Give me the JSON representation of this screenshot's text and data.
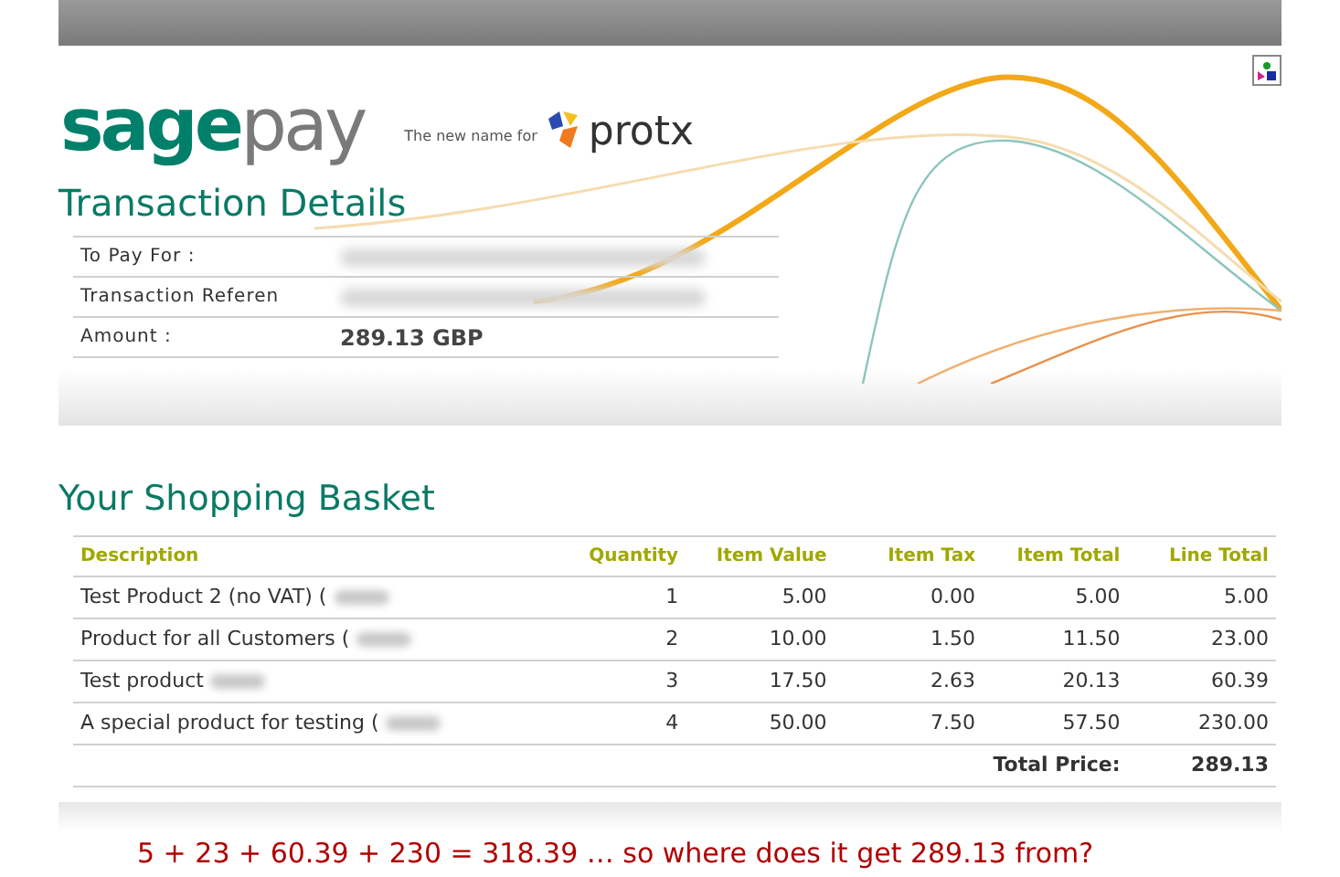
{
  "header": {
    "logo_left": "sage",
    "logo_right": "pay",
    "tagline": "The new name for",
    "partner": "protx"
  },
  "transaction": {
    "title": "Transaction Details",
    "rows": [
      {
        "label": "To Pay For :",
        "value": null
      },
      {
        "label": "Transaction Referen",
        "value": null
      },
      {
        "label": "Amount :",
        "value": "289.13 GBP"
      }
    ]
  },
  "basket": {
    "title": "Your Shopping Basket",
    "columns": [
      "Description",
      "Quantity",
      "Item Value",
      "Item Tax",
      "Item Total",
      "Line Total"
    ],
    "rows": [
      {
        "cells": [
          "Test Product 2 (no VAT) (",
          "1",
          "5.00",
          "0.00",
          "5.00",
          "5.00"
        ]
      },
      {
        "cells": [
          "Product for all Customers (",
          "2",
          "10.00",
          "1.50",
          "11.50",
          "23.00"
        ]
      },
      {
        "cells": [
          "Test product",
          "3",
          "17.50",
          "2.63",
          "20.13",
          "60.39"
        ]
      },
      {
        "cells": [
          "A special product for testing (",
          "4",
          "50.00",
          "7.50",
          "57.50",
          "230.00"
        ]
      }
    ],
    "total_label": "Total Price:",
    "total_value": "289.13"
  },
  "annotation": "5 + 23 + 60.39 + 230 = 318.39 … so where does it get 289.13 from?"
}
